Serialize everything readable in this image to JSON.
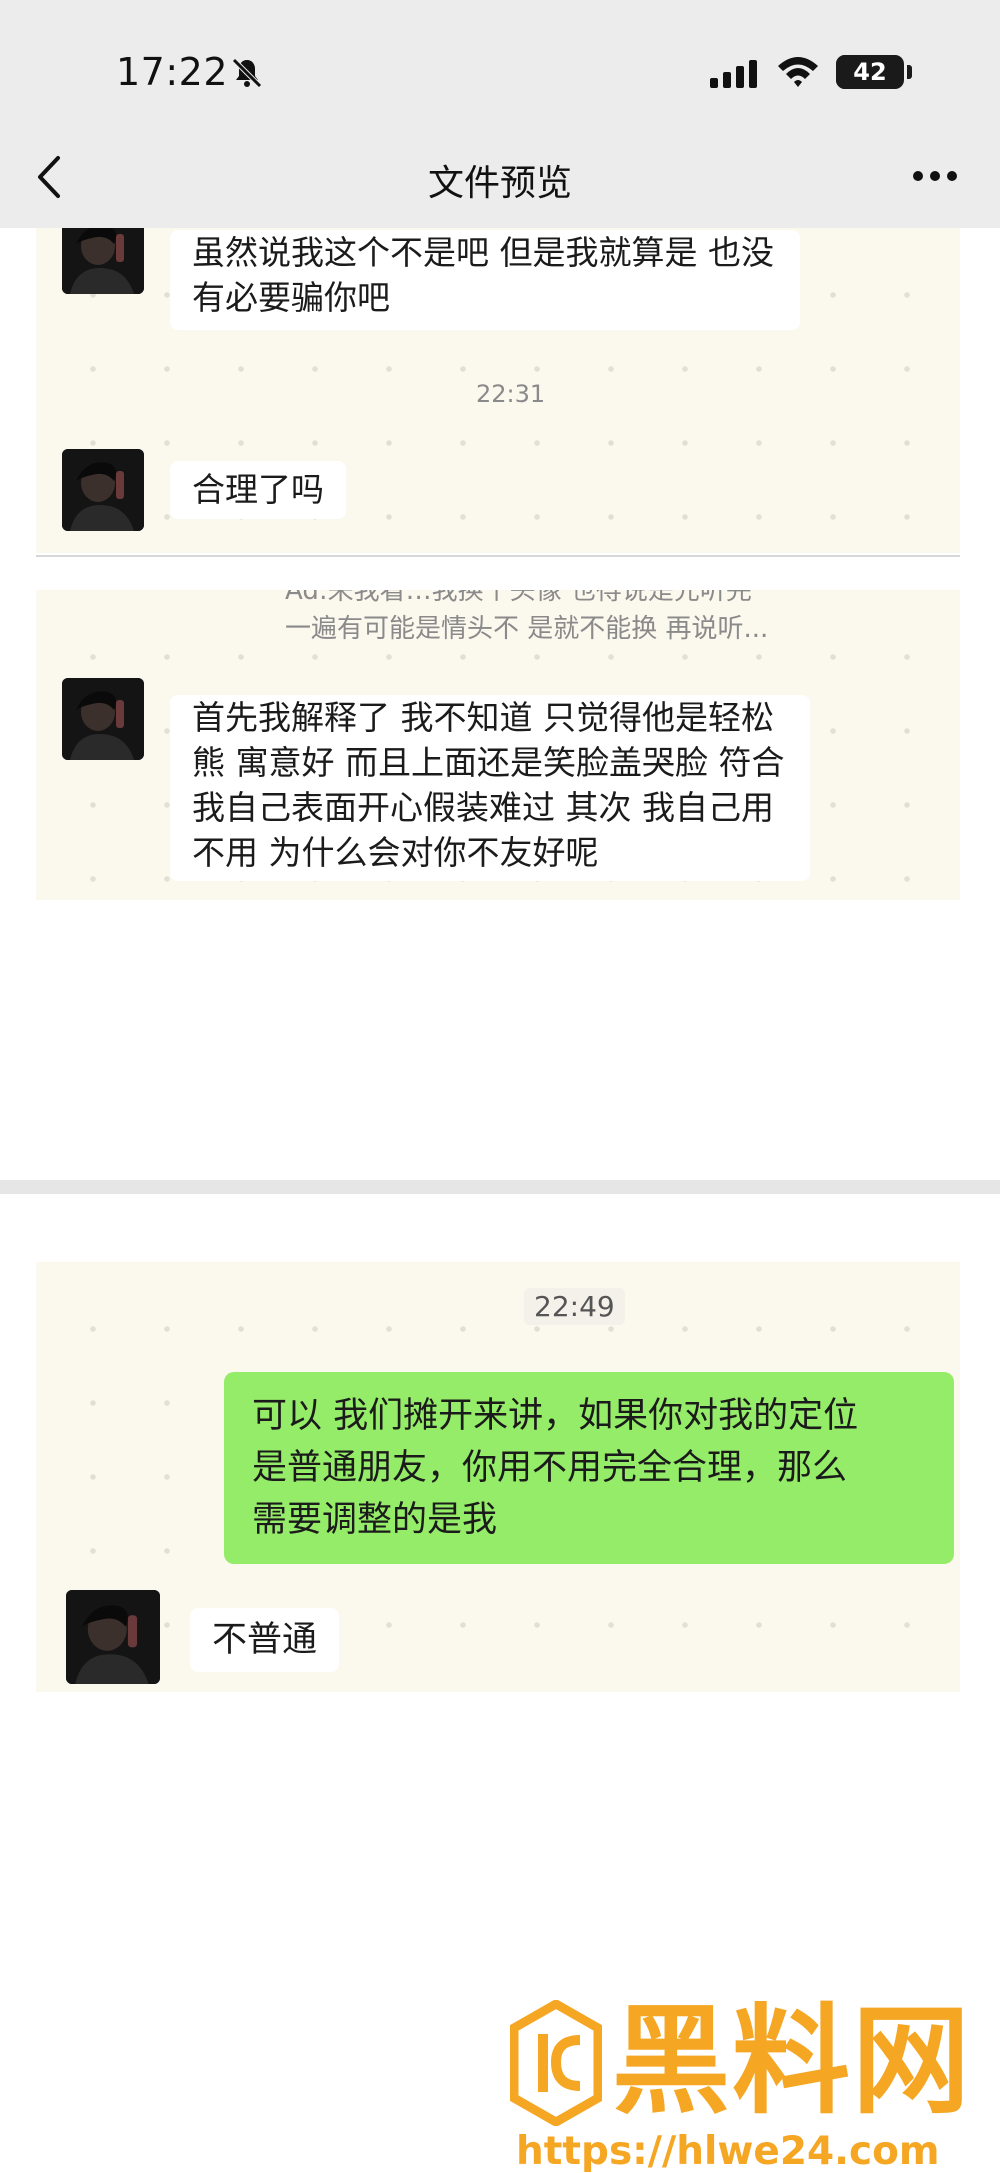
{
  "status_bar": {
    "time": "17:22",
    "battery": "42",
    "battery_fraction": 0.42
  },
  "nav": {
    "title": "文件预览"
  },
  "shot1": {
    "msg1_line1": "虽然说我这个不是吧 但是我就算是 也没",
    "msg1_line2": "有必要骗你吧",
    "timestamp": "22:31",
    "msg2": "合理了吗"
  },
  "shot2": {
    "quote_line1": "Ad:来我看…我换个头像 也得说是先听完",
    "quote_line2": "一遍有可能是情头不 是就不能换 再说听...",
    "msg_line1": "首先我解释了 我不知道 只觉得他是轻松",
    "msg_line2": "熊 寓意好 而且上面还是笑脸盖哭脸 符合",
    "msg_line3": "我自己表面开心假装难过 其次 我自己用",
    "msg_line4": "不用 为什么会对你不友好呢"
  },
  "shot3": {
    "timestamp": "22:49",
    "sent_line1": "可以 我们摊开来讲，如果你对我的定位",
    "sent_line2": "是普通朋友，你用不用完全合理，那么",
    "sent_line3": "需要调整的是我",
    "reply": "不普通"
  },
  "watermark": {
    "brand": "黑料网",
    "url": "https://hlwe24.com"
  },
  "colors": {
    "sent_bubble": "#95ec69",
    "watermark": "#f5a623",
    "chat_bg": "#fbf8ee"
  }
}
